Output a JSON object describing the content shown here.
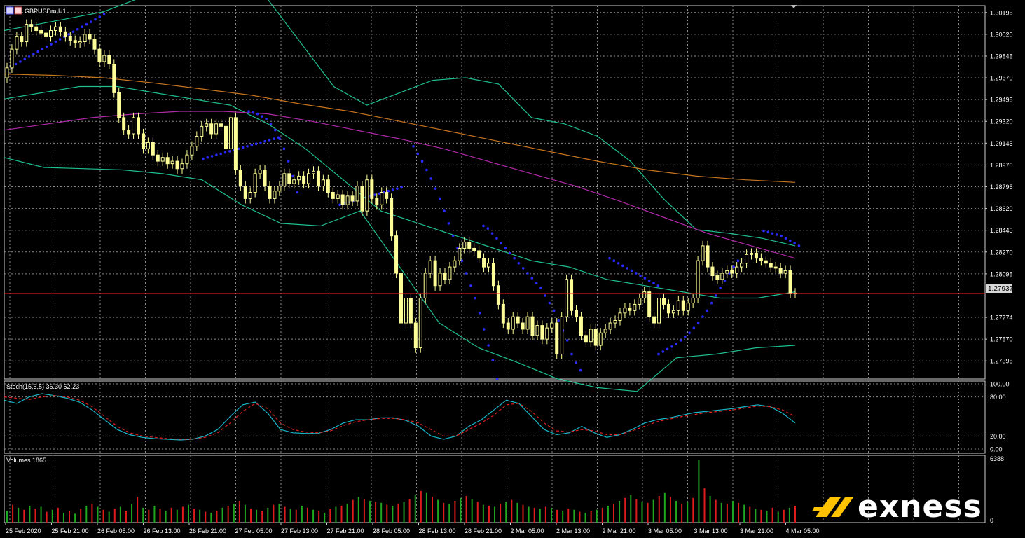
{
  "symbol_label": "GBPUSDm,H1",
  "current_price_label": "1.27937",
  "stoch_label": "Stoch(15,5,5) 36.30 52.23",
  "volumes_label": "Volumes 1865",
  "brand": "exness",
  "colors": {
    "background": "#000000",
    "grid": "#8a8a8a",
    "candle": "#ffff99",
    "bollinger": "#1fbf8f",
    "ma_magenta": "#b02aa8",
    "ma_orange": "#c8741f",
    "sar": "#2a2aff",
    "price_line": "#ff2020",
    "stoch_main": "#19b7c9",
    "stoch_signal": "#e02020",
    "vol_up": "#1fa81f",
    "vol_down": "#e01b1b",
    "logo_accent": "#ffc200"
  },
  "price_axis": {
    "labels": [
      "1.30195",
      "1.30020",
      "1.29845",
      "1.29670",
      "1.29495",
      "1.29320",
      "1.29145",
      "1.28970",
      "1.28795",
      "1.28620",
      "1.28445",
      "1.28270",
      "1.28095",
      "1.27774",
      "1.27570",
      "1.27395"
    ],
    "values": [
      1.30195,
      1.3002,
      1.29845,
      1.2967,
      1.29495,
      1.2932,
      1.29145,
      1.2897,
      1.28795,
      1.2862,
      1.28445,
      1.2827,
      1.28095,
      1.27745,
      1.2757,
      1.27395
    ],
    "current_price": 1.27937
  },
  "stoch_axis": {
    "labels": [
      "100.00",
      "80.00",
      "20.00",
      "0.00"
    ],
    "values": [
      100,
      80,
      20,
      0
    ]
  },
  "volume_axis": {
    "labels": [
      "6388",
      "0"
    ],
    "values": [
      6388,
      0
    ]
  },
  "time_axis": [
    "25 Feb 2020",
    "25 Feb 21:00",
    "26 Feb 05:00",
    "26 Feb 13:00",
    "26 Feb 21:00",
    "27 Feb 05:00",
    "27 Feb 13:00",
    "27 Feb 21:00",
    "28 Feb 05:00",
    "28 Feb 13:00",
    "28 Feb 21:00",
    "2 Mar 05:00",
    "2 Mar 13:00",
    "2 Mar 21:00",
    "3 Mar 05:00",
    "3 Mar 13:00",
    "3 Mar 21:00",
    "4 Mar 05:00"
  ],
  "chart_data": {
    "type": "candlestick",
    "title": "GBPUSDm,H1",
    "ylim": [
      1.2725,
      1.3025
    ],
    "close": [
      1.2975,
      1.299,
      1.3,
      1.2996,
      1.301,
      1.3008,
      1.3005,
      1.3003,
      1.3,
      1.3005,
      1.3008,
      1.3004,
      1.3,
      1.2997,
      1.2995,
      1.2996,
      1.3002,
      1.2998,
      1.299,
      1.298,
      1.2985,
      1.2978,
      1.2955,
      1.2935,
      1.2925,
      1.2922,
      1.2935,
      1.2922,
      1.291,
      1.2915,
      1.2905,
      1.29,
      1.2903,
      1.2898,
      1.29,
      1.2894,
      1.2898,
      1.2905,
      1.2912,
      1.292,
      1.2928,
      1.293,
      1.2922,
      1.293,
      1.2928,
      1.291,
      1.2935,
      1.2893,
      1.288,
      1.287,
      1.2875,
      1.289,
      1.2893,
      1.288,
      1.287,
      1.2876,
      1.288,
      1.289,
      1.2882,
      1.2885,
      1.2888,
      1.2882,
      1.289,
      1.2892,
      1.288,
      1.2885,
      1.2875,
      1.287,
      1.2873,
      1.2865,
      1.2872,
      1.2868,
      1.288,
      1.286,
      1.2885,
      1.287,
      1.2865,
      1.2875,
      1.287,
      1.284,
      1.281,
      1.277,
      1.279,
      1.277,
      1.275,
      1.279,
      1.281,
      1.282,
      1.28,
      1.281,
      1.2805,
      1.2815,
      1.282,
      1.283,
      1.2835,
      1.283,
      1.2828,
      1.2822,
      1.2815,
      1.2818,
      1.28,
      1.2785,
      1.277,
      1.2765,
      1.2775,
      1.277,
      1.2765,
      1.2775,
      1.276,
      1.2768,
      1.2757,
      1.2766,
      1.277,
      1.2745,
      1.2775,
      1.2805,
      1.278,
      1.2775,
      1.276,
      1.2755,
      1.2765,
      1.2752,
      1.2762,
      1.2765,
      1.277,
      1.2772,
      1.2778,
      1.2782,
      1.278,
      1.2785,
      1.279,
      1.2795,
      1.2775,
      1.277,
      1.279,
      1.2785,
      1.2778,
      1.278,
      1.2788,
      1.278,
      1.2786,
      1.279,
      1.282,
      1.2832,
      1.2815,
      1.2808,
      1.2805,
      1.281,
      1.2812,
      1.281,
      1.2815,
      1.2818,
      1.2825,
      1.2826,
      1.2822,
      1.282,
      1.2818,
      1.2815,
      1.2814,
      1.281,
      1.2812,
      1.2794,
      1.2794
    ],
    "sar": [
      [
        1.297,
        1.2975,
        1.2978,
        1.298,
        1.2982,
        1.2984,
        1.2986,
        1.2988,
        1.299,
        1.2992,
        1.2994,
        1.2996,
        1.2998,
        1.3,
        1.3002,
        1.3004,
        1.3006,
        1.3008,
        1.301,
        1.3012,
        1.3014,
        1.3016,
        1.3018
      ],
      [
        1.2902,
        1.2903,
        1.2904,
        1.2905,
        1.2906,
        1.2907,
        1.2908,
        1.2909,
        1.291,
        1.2911,
        1.2912,
        1.2913,
        1.2914,
        1.2915,
        1.2916,
        1.2917,
        1.2918,
        1.2919
      ],
      [
        1.294,
        1.2939,
        1.2938,
        1.2936,
        1.2934,
        1.293,
        1.2925,
        1.2918,
        1.291,
        1.29,
        1.2888,
        1.2875
      ],
      [
        1.2865,
        1.2866,
        1.2867,
        1.2868,
        1.2869,
        1.287,
        1.2871,
        1.2872,
        1.2873,
        1.2874,
        1.2875,
        1.2876,
        1.2877,
        1.2878,
        1.2879
      ],
      [
        1.2912,
        1.2906,
        1.29,
        1.2893,
        1.2886,
        1.2878,
        1.287,
        1.286,
        1.285,
        1.284,
        1.283,
        1.282,
        1.281,
        1.28,
        1.279,
        1.2778,
        1.2765,
        1.2752,
        1.274,
        1.2725
      ],
      [
        1.2848,
        1.2846,
        1.2842,
        1.2838,
        1.2834,
        1.283,
        1.2826,
        1.2822,
        1.2818,
        1.2814,
        1.281,
        1.2806,
        1.2802,
        1.2798,
        1.2792,
        1.2786,
        1.278,
        1.2772,
        1.2764,
        1.2756,
        1.2745,
        1.2738,
        1.2732
      ],
      [
        1.2822,
        1.282,
        1.2818,
        1.2816,
        1.2814,
        1.2812,
        1.281,
        1.2808,
        1.2806,
        1.2804,
        1.2802,
        1.28
      ],
      [
        1.2745,
        1.2747,
        1.2749,
        1.2751,
        1.2753,
        1.2756,
        1.2759,
        1.2762,
        1.2766,
        1.277,
        1.2775,
        1.278,
        1.2786,
        1.2792,
        1.2798,
        1.2804,
        1.281,
        1.2815,
        1.282
      ],
      [
        1.2844,
        1.2843,
        1.2842,
        1.2841,
        1.284,
        1.2838,
        1.2836,
        1.2834,
        1.2832
      ]
    ],
    "bollinger_upper": [
      1.3005,
      1.301,
      1.3015,
      1.302,
      1.303,
      1.3045,
      1.306,
      1.305,
      1.303,
      1.2995,
      1.296,
      1.2945,
      1.2955,
      1.2965,
      1.2967,
      1.2962,
      1.2935,
      1.293,
      1.292,
      1.29,
      1.287,
      1.2845,
      1.2842,
      1.2838,
      1.2832
    ],
    "bollinger_middle": [
      1.295,
      1.2955,
      1.296,
      1.296,
      1.2955,
      1.295,
      1.2945,
      1.293,
      1.291,
      1.2885,
      1.286,
      1.285,
      1.284,
      1.283,
      1.282,
      1.2815,
      1.2805,
      1.28,
      1.2795,
      1.279,
      1.279,
      1.2795
    ],
    "bollinger_lower": [
      1.2903,
      1.2895,
      1.2894,
      1.2893,
      1.289,
      1.2885,
      1.2865,
      1.285,
      1.2848,
      1.286,
      1.2815,
      1.277,
      1.275,
      1.2738,
      1.2725,
      1.2718,
      1.2715,
      1.2742,
      1.2745,
      1.275,
      1.2752
    ],
    "ma_magenta": [
      1.2925,
      1.293,
      1.2935,
      1.2938,
      1.294,
      1.294,
      1.2938,
      1.2932,
      1.2925,
      1.2918,
      1.291,
      1.29,
      1.289,
      1.288,
      1.2868,
      1.2855,
      1.2842,
      1.2832,
      1.2822
    ],
    "ma_orange": [
      1.297,
      1.2969,
      1.2967,
      1.2963,
      1.2958,
      1.2953,
      1.2946,
      1.294,
      1.2932,
      1.2924,
      1.2916,
      1.2908,
      1.29,
      1.2893,
      1.2888,
      1.2885,
      1.2883
    ],
    "stoch_main": [
      75,
      70,
      80,
      85,
      82,
      78,
      72,
      60,
      45,
      30,
      22,
      18,
      16,
      15,
      14,
      15,
      20,
      30,
      50,
      68,
      72,
      55,
      30,
      25,
      24,
      24,
      30,
      40,
      45,
      45,
      48,
      48,
      44,
      35,
      20,
      15,
      20,
      35,
      45,
      60,
      75,
      70,
      50,
      30,
      22,
      25,
      35,
      25,
      18,
      22,
      30,
      40,
      45,
      48,
      52,
      56,
      58,
      60,
      62,
      65,
      68,
      65,
      55,
      40
    ],
    "stoch_signal": [
      80,
      78,
      76,
      80,
      82,
      80,
      75,
      65,
      50,
      35,
      25,
      20,
      18,
      16,
      15,
      15,
      18,
      25,
      40,
      58,
      70,
      62,
      40,
      30,
      26,
      25,
      28,
      36,
      42,
      45,
      47,
      47,
      45,
      40,
      30,
      20,
      20,
      30,
      40,
      52,
      68,
      70,
      58,
      40,
      28,
      26,
      30,
      28,
      22,
      22,
      28,
      35,
      42,
      46,
      50,
      53,
      56,
      58,
      60,
      63,
      66,
      65,
      60,
      50
    ],
    "volumes": [
      [
        1200,
        0
      ],
      [
        1800,
        1
      ],
      [
        1500,
        0
      ],
      [
        1300,
        1
      ],
      [
        1700,
        0
      ],
      [
        1400,
        1
      ],
      [
        1600,
        0
      ],
      [
        1100,
        1
      ],
      [
        1300,
        0
      ],
      [
        1500,
        1
      ],
      [
        1000,
        0
      ],
      [
        1200,
        1
      ],
      [
        900,
        0
      ],
      [
        1400,
        1
      ],
      [
        1700,
        0
      ],
      [
        1900,
        1
      ],
      [
        1600,
        0
      ],
      [
        1300,
        1
      ],
      [
        1100,
        0
      ],
      [
        1400,
        1
      ],
      [
        1600,
        0
      ],
      [
        1200,
        1
      ],
      [
        1900,
        0
      ],
      [
        2600,
        1
      ],
      [
        1500,
        0
      ],
      [
        1300,
        1
      ],
      [
        1700,
        0
      ],
      [
        1400,
        1
      ],
      [
        1200,
        0
      ],
      [
        1500,
        1
      ],
      [
        1300,
        0
      ],
      [
        1600,
        1
      ],
      [
        1800,
        0
      ],
      [
        1400,
        1
      ],
      [
        1300,
        0
      ],
      [
        1100,
        1
      ],
      [
        1000,
        0
      ],
      [
        1200,
        1
      ],
      [
        1500,
        0
      ],
      [
        1700,
        1
      ],
      [
        1900,
        0
      ],
      [
        2200,
        1
      ],
      [
        1800,
        0
      ],
      [
        1400,
        1
      ],
      [
        1300,
        0
      ],
      [
        1200,
        1
      ],
      [
        1500,
        0
      ],
      [
        1800,
        1
      ],
      [
        1900,
        0
      ],
      [
        1600,
        1
      ],
      [
        1400,
        0
      ],
      [
        1300,
        1
      ],
      [
        1700,
        0
      ],
      [
        1500,
        1
      ],
      [
        1300,
        0
      ],
      [
        1200,
        1
      ],
      [
        1000,
        0
      ],
      [
        1400,
        1
      ],
      [
        1600,
        0
      ],
      [
        1700,
        1
      ],
      [
        1900,
        0
      ],
      [
        2300,
        1
      ],
      [
        2600,
        0
      ],
      [
        2400,
        1
      ],
      [
        2200,
        0
      ],
      [
        2100,
        1
      ],
      [
        2000,
        0
      ],
      [
        1800,
        1
      ],
      [
        1700,
        0
      ],
      [
        1900,
        1
      ],
      [
        2100,
        0
      ],
      [
        2400,
        1
      ],
      [
        2800,
        0
      ],
      [
        3200,
        1
      ],
      [
        3000,
        0
      ],
      [
        2600,
        1
      ],
      [
        2300,
        0
      ],
      [
        2000,
        1
      ],
      [
        1900,
        0
      ],
      [
        2200,
        1
      ],
      [
        2500,
        0
      ],
      [
        2700,
        1
      ],
      [
        2400,
        0
      ],
      [
        2100,
        1
      ],
      [
        1800,
        0
      ],
      [
        1700,
        1
      ],
      [
        1600,
        0
      ],
      [
        1900,
        1
      ],
      [
        2100,
        0
      ],
      [
        2300,
        1
      ],
      [
        2000,
        0
      ],
      [
        1800,
        1
      ],
      [
        1600,
        0
      ],
      [
        1500,
        1
      ],
      [
        1400,
        0
      ],
      [
        1600,
        1
      ],
      [
        1500,
        0
      ],
      [
        1300,
        1
      ],
      [
        1200,
        0
      ],
      [
        1400,
        1
      ],
      [
        1300,
        0
      ],
      [
        1100,
        1
      ],
      [
        1000,
        0
      ],
      [
        1200,
        1
      ],
      [
        1300,
        0
      ],
      [
        1500,
        1
      ],
      [
        1700,
        0
      ],
      [
        1900,
        1
      ],
      [
        2200,
        0
      ],
      [
        2500,
        1
      ],
      [
        2800,
        0
      ],
      [
        2400,
        1
      ],
      [
        2100,
        0
      ],
      [
        2000,
        1
      ],
      [
        2300,
        0
      ],
      [
        2700,
        1
      ],
      [
        3000,
        0
      ],
      [
        2600,
        1
      ],
      [
        2200,
        0
      ],
      [
        1900,
        1
      ],
      [
        2100,
        0
      ],
      [
        2500,
        1
      ],
      [
        6388,
        0
      ],
      [
        3500,
        1
      ],
      [
        2700,
        0
      ],
      [
        2300,
        1
      ],
      [
        2000,
        0
      ],
      [
        1900,
        1
      ],
      [
        2200,
        0
      ],
      [
        2000,
        1
      ],
      [
        1800,
        0
      ],
      [
        1600,
        1
      ],
      [
        1400,
        0
      ],
      [
        1300,
        1
      ],
      [
        1200,
        0
      ],
      [
        1500,
        1
      ],
      [
        1100,
        0
      ],
      [
        1300,
        1
      ],
      [
        1500,
        0
      ],
      [
        1700,
        1
      ]
    ]
  }
}
